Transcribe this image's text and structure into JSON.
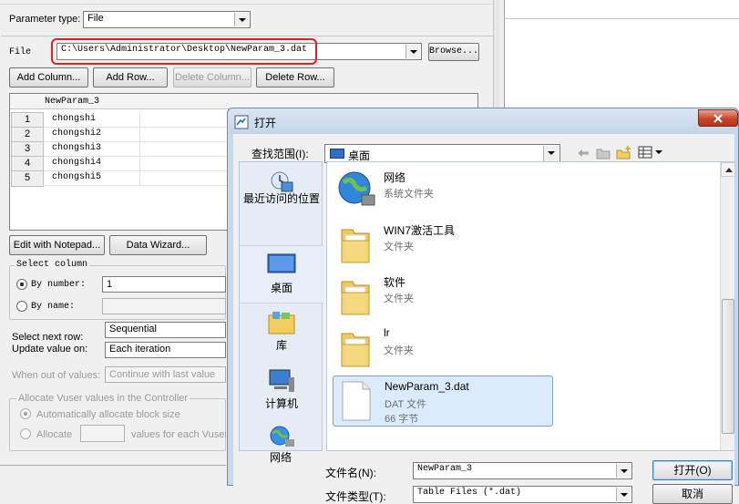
{
  "param_panel": {
    "parameter_type_label": "Parameter type:",
    "parameter_type_value": "File",
    "file_label": "File",
    "file_path": "C:\\Users\\Administrator\\Desktop\\NewParam_3.dat",
    "browse_label": "Browse...",
    "buttons": {
      "add_column": "Add Column...",
      "add_row": "Add Row...",
      "delete_column": "Delete Column...",
      "delete_row": "Delete Row..."
    },
    "table": {
      "column_header": "NewParam_3",
      "rows": [
        {
          "num": "1",
          "value": "chongshi"
        },
        {
          "num": "2",
          "value": "chongshi2"
        },
        {
          "num": "3",
          "value": "chongshi3"
        },
        {
          "num": "4",
          "value": "chongshi4"
        },
        {
          "num": "5",
          "value": "chongshi5"
        }
      ]
    },
    "edit_with_notepad": "Edit with Notepad...",
    "data_wizard": "Data Wizard...",
    "select_column": {
      "title": "Select column",
      "by_number_label": "By number:",
      "by_number_value": "1",
      "by_name_label": "By name:"
    },
    "select_next_row_label": "Select next row:",
    "select_next_row_value": "Sequential",
    "update_value_on_label": "Update value on:",
    "update_value_on_value": "Each iteration",
    "when_out_of_values_label": "When out of values:",
    "when_out_of_values_value": "Continue with last value",
    "allocate_group": {
      "title": "Allocate Vuser values in the Controller",
      "auto_label": "Automatically allocate block size",
      "allocate_label": "Allocate",
      "values_for_each": "values for each Vuser"
    }
  },
  "open_dialog": {
    "title": "打开",
    "look_in_label": "查找范围(I):",
    "look_in_value": "桌面",
    "places": [
      {
        "label": "最近访问的位置",
        "icon": "recent-places-icon"
      },
      {
        "label": "桌面",
        "icon": "desktop-icon"
      },
      {
        "label": "库",
        "icon": "libraries-icon"
      },
      {
        "label": "计算机",
        "icon": "computer-icon"
      },
      {
        "label": "网络",
        "icon": "network-icon"
      }
    ],
    "files": [
      {
        "name": "网络",
        "type": "系统文件夹",
        "icon": "network-icon"
      },
      {
        "name": "WIN7激活工具",
        "type": "文件夹",
        "icon": "folder-icon"
      },
      {
        "name": "软件",
        "type": "文件夹",
        "icon": "folder-icon"
      },
      {
        "name": "lr",
        "type": "文件夹",
        "icon": "folder-icon"
      },
      {
        "name": "NewParam_3.dat",
        "type": "DAT 文件",
        "size": "66 字节",
        "icon": "document-icon"
      }
    ],
    "file_name_label": "文件名(N):",
    "file_name_value": "NewParam_3",
    "file_type_label": "文件类型(T):",
    "file_type_value": "Table Files (*.dat)",
    "open_button": "打开(O)",
    "cancel_button": "取消"
  },
  "colors": {
    "highlight_border": "#e02020",
    "selection_fill": "#dcebfc",
    "dialog_frame": "#c9d9ec"
  }
}
